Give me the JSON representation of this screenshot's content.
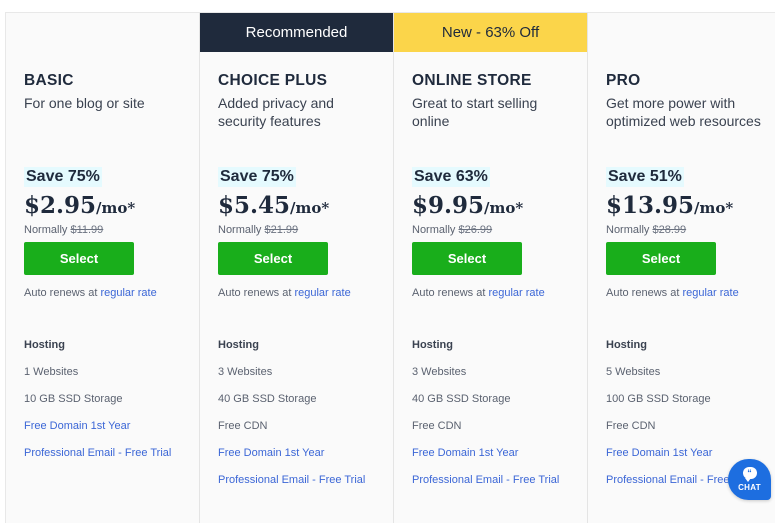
{
  "plans": [
    {
      "ribbon": "",
      "ribbon_style": "none",
      "name": "BASIC",
      "description": "For one blog or site",
      "save": "Save 75%",
      "price": "$2.95",
      "price_unit": "/mo*",
      "normally_label": "Normally",
      "normal_price": "$11.99",
      "select_label": "Select",
      "renew_text": "Auto renews at",
      "renew_link": "regular rate",
      "features_heading": "Hosting",
      "features": [
        {
          "text": "1 Websites",
          "link": false
        },
        {
          "text": "10 GB SSD Storage",
          "link": false
        },
        {
          "text": "Free Domain 1st Year",
          "link": true
        },
        {
          "text": "Professional Email - Free Trial",
          "link": true
        }
      ]
    },
    {
      "ribbon": "Recommended",
      "ribbon_style": "dark",
      "name": "CHOICE PLUS",
      "description": "Added privacy and security features",
      "save": "Save 75%",
      "price": "$5.45",
      "price_unit": "/mo*",
      "normally_label": "Normally",
      "normal_price": "$21.99",
      "select_label": "Select",
      "renew_text": "Auto renews at",
      "renew_link": "regular rate",
      "features_heading": "Hosting",
      "features": [
        {
          "text": "3 Websites",
          "link": false
        },
        {
          "text": "40 GB SSD Storage",
          "link": false
        },
        {
          "text": "Free CDN",
          "link": false
        },
        {
          "text": "Free Domain 1st Year",
          "link": true
        },
        {
          "text": "Professional Email - Free Trial",
          "link": true
        }
      ]
    },
    {
      "ribbon": "New - 63% Off",
      "ribbon_style": "yellow",
      "name": "ONLINE STORE",
      "description": "Great to start selling online",
      "save": "Save 63%",
      "price": "$9.95",
      "price_unit": "/mo*",
      "normally_label": "Normally",
      "normal_price": "$26.99",
      "select_label": "Select",
      "renew_text": "Auto renews at",
      "renew_link": "regular rate",
      "features_heading": "Hosting",
      "features": [
        {
          "text": "3 Websites",
          "link": false
        },
        {
          "text": "40 GB SSD Storage",
          "link": false
        },
        {
          "text": "Free CDN",
          "link": false
        },
        {
          "text": "Free Domain 1st Year",
          "link": true
        },
        {
          "text": "Professional Email - Free Trial",
          "link": true
        }
      ]
    },
    {
      "ribbon": "",
      "ribbon_style": "none",
      "name": "PRO",
      "description": "Get more power with optimized web resources",
      "save": "Save 51%",
      "price": "$13.95",
      "price_unit": "/mo*",
      "normally_label": "Normally",
      "normal_price": "$28.99",
      "select_label": "Select",
      "renew_text": "Auto renews at",
      "renew_link": "regular rate",
      "features_heading": "Hosting",
      "features": [
        {
          "text": "5 Websites",
          "link": false
        },
        {
          "text": "100 GB SSD Storage",
          "link": false
        },
        {
          "text": "Free CDN",
          "link": false
        },
        {
          "text": "Free Domain 1st Year",
          "link": true
        },
        {
          "text": "Professional Email - Free Trial",
          "link": true
        }
      ]
    }
  ],
  "chat": {
    "label": "CHAT",
    "icon": "chat-bubble-icon"
  },
  "colors": {
    "recommended_ribbon": "#1f2a3c",
    "new_ribbon": "#fbd54a",
    "select_button": "#19ae1b",
    "link": "#3b66d6",
    "save_badge_bg": "#e5fafe",
    "chat_button": "#1d6ee0"
  }
}
